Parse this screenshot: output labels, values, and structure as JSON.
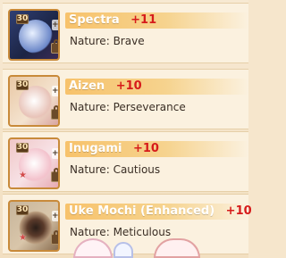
{
  "entries": [
    {
      "level": "30",
      "upgrade": "+11",
      "name": "Spectra",
      "plus": "+11",
      "nature_label": "Nature:",
      "nature": "Brave"
    },
    {
      "level": "30",
      "upgrade": "+10",
      "name": "Aizen",
      "plus": "+10",
      "nature_label": "Nature:",
      "nature": "Perseverance"
    },
    {
      "level": "30",
      "upgrade": "+10",
      "name": "Inugami",
      "plus": "+10",
      "nature_label": "Nature:",
      "nature": "Cautious"
    },
    {
      "level": "30",
      "upgrade": "+10",
      "name": "Uke Mochi (Enhanced)",
      "plus": "+10",
      "nature_label": "Nature:",
      "nature": "Meticulous"
    }
  ],
  "icons": {
    "lock": "lock-icon",
    "star": "star-icon"
  }
}
